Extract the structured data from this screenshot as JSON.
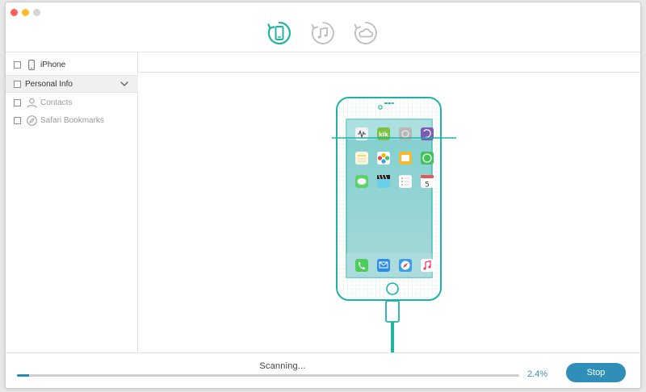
{
  "window": {
    "controls": [
      "close",
      "minimize",
      "zoom"
    ]
  },
  "toolbar": {
    "modes": [
      {
        "name": "recover-from-ios-device",
        "icon": "phone-refresh-icon",
        "active": true
      },
      {
        "name": "recover-from-itunes-backup",
        "icon": "music-refresh-icon",
        "active": false
      },
      {
        "name": "recover-from-icloud-backup",
        "icon": "cloud-refresh-icon",
        "active": false
      }
    ]
  },
  "sidebar": {
    "device": {
      "label": "iPhone",
      "icon": "phone-icon"
    },
    "group": {
      "label": "Personal Info",
      "expanded": true
    },
    "items": [
      {
        "label": "Contacts",
        "icon": "person-icon"
      },
      {
        "label": "Safari Bookmarks",
        "icon": "compass-icon"
      }
    ]
  },
  "status": {
    "text": "Scanning...",
    "progress_percent": 2.4,
    "percent_label": "2.4%",
    "stop_label": "Stop"
  },
  "colors": {
    "accent": "#2f8fb8",
    "teal": "#1fb3a6",
    "inactive_icon": "#bdbdbd"
  }
}
